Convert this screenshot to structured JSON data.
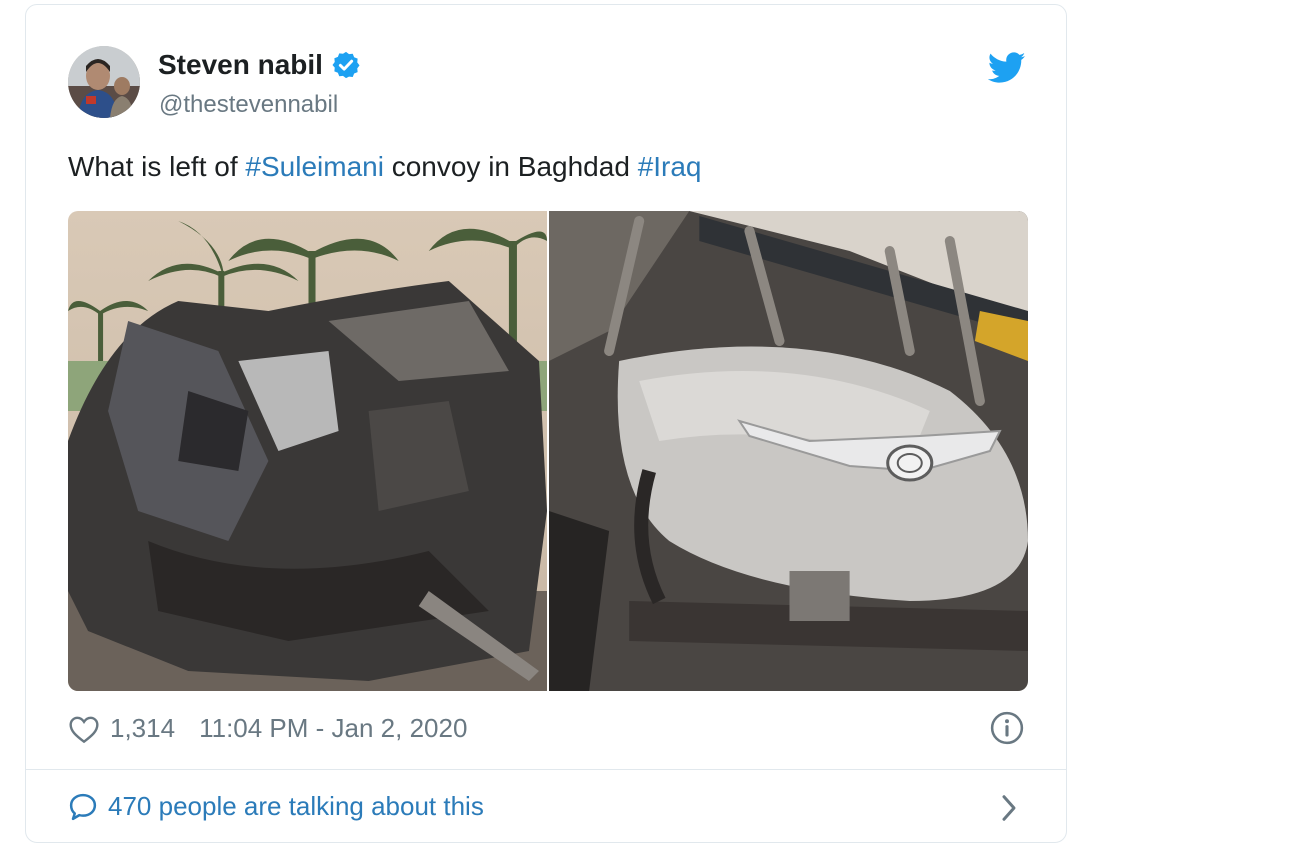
{
  "user": {
    "name": "Steven nabil",
    "handle": "@thestevennabil",
    "verified": true,
    "avatar_icon": "avatar-photo"
  },
  "tweet": {
    "segments": [
      {
        "text": "What is left of ",
        "hashtag": false
      },
      {
        "text": "#Suleimani",
        "hashtag": true
      },
      {
        "text": " convoy in Baghdad ",
        "hashtag": false
      },
      {
        "text": "#Iraq",
        "hashtag": true
      }
    ]
  },
  "media": {
    "photos": [
      {
        "subject": "burned vehicle wreck with palm trees"
      },
      {
        "subject": "burned Toyota vehicle front"
      }
    ]
  },
  "meta": {
    "likes": "1,314",
    "timestamp": "11:04 PM - Jan 2, 2020"
  },
  "footer": {
    "talking": "470 people are talking about this"
  },
  "icons": {
    "brand": "twitter-bird-icon",
    "like": "heart-icon",
    "info": "info-icon",
    "reply": "speech-bubble-icon",
    "more": "chevron-right-icon"
  },
  "colors": {
    "link": "#2b7bb9",
    "twitter_blue": "#1da1f2",
    "muted": "#697882",
    "text": "#1c2022",
    "border": "#e1e8ed"
  }
}
